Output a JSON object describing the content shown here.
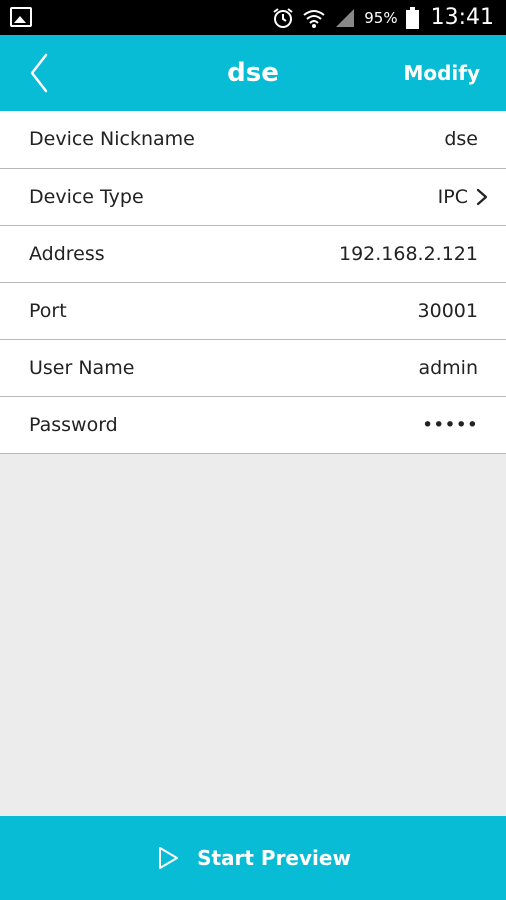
{
  "status_bar": {
    "battery_percent": "95%",
    "time": "13:41"
  },
  "app_bar": {
    "title": "dse",
    "modify_label": "Modify"
  },
  "details": [
    {
      "label": "Device Nickname",
      "value": "dse"
    },
    {
      "label": "Device Type",
      "value": "IPC"
    },
    {
      "label": "Address",
      "value": "192.168.2.121"
    },
    {
      "label": "Port",
      "value": "30001"
    },
    {
      "label": "User Name",
      "value": "admin"
    },
    {
      "label": "Password",
      "value": "•••••"
    }
  ],
  "bottom_bar": {
    "start_preview_label": "Start Preview"
  },
  "colors": {
    "accent": "#09bcd5",
    "background": "#ececec"
  },
  "icons": {
    "back": "chevron-left-icon",
    "device_type_arrow": "chevron-right-icon",
    "start_preview": "play-icon"
  }
}
